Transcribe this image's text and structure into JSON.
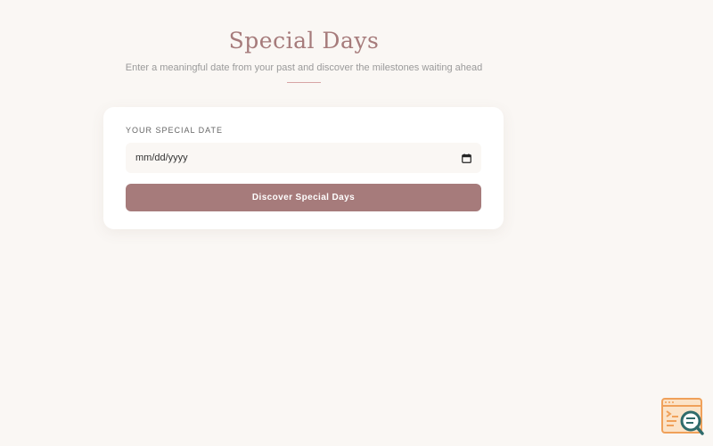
{
  "header": {
    "title": "Special Days",
    "subtitle": "Enter a meaningful date from your past and discover the milestones waiting ahead"
  },
  "form": {
    "date_label": "YOUR SPECIAL DATE",
    "date_placeholder": "mm/dd/yyyy",
    "submit_label": "Discover Special Days"
  },
  "icons": {
    "calendar": "calendar-icon",
    "badge": "code-search-badge-icon"
  },
  "colors": {
    "background": "#faf7f4",
    "accent": "#a67b7b",
    "divider": "#d8a5a5",
    "badge_orange": "#f0a15a",
    "badge_teal": "#2f6b6b"
  }
}
